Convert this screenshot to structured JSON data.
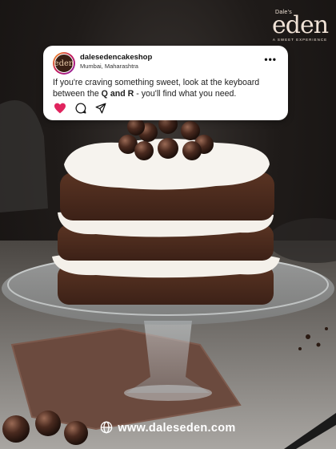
{
  "brand": {
    "pre": "Dale's",
    "word": "eden",
    "tagline": "A SWEET EXPERIENCE"
  },
  "post": {
    "username": "dalesedencakeshop",
    "location": "Mumbai, Maharashtra",
    "caption_start": "If you're craving something sweet, look at the keyboard between the ",
    "caption_q": "Q and R",
    "caption_end": " - you'll find what you need.",
    "avatar_text": "eden",
    "more_icon": "more-dots-icon",
    "icons": [
      "heart-icon",
      "comment-icon",
      "share-icon"
    ],
    "colors": {
      "heart": "#e0245e",
      "card": "#ffffff"
    }
  },
  "footer": {
    "url": "www.daleseden.com",
    "icon": "globe-icon"
  }
}
